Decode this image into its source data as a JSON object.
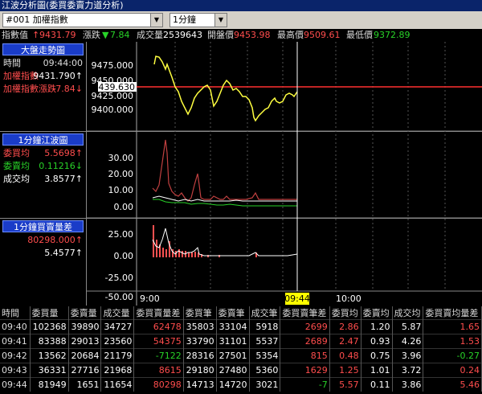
{
  "window": {
    "title": "江波分析圖(委買委賣力道分析)"
  },
  "controls": {
    "symbol": "#001 加權指數",
    "interval": "1分鐘"
  },
  "quote": {
    "index_label": "指數值",
    "index_arrow": "↑",
    "index_value": "9431.79",
    "change_label": "漲跌",
    "change_arrow": "▼",
    "change_value": "7.84",
    "volume_label": "成交量",
    "volume_value": "2539643",
    "open_label": "開盤價",
    "open_value": "9453.98",
    "high_label": "最高價",
    "high_value": "9509.61",
    "low_label": "最低價",
    "low_value": "9372.89"
  },
  "panel1": {
    "title": "大盤走勢圖",
    "rows": [
      {
        "label": "時間",
        "value": "09:44:00"
      },
      {
        "label": "加權指數",
        "value": "9431.790↑"
      },
      {
        "label": "加權指數漲跌",
        "value": "-7.84↓"
      }
    ],
    "y_ticks": [
      "9475.000",
      "9450.000",
      "9425.000",
      "9400.000"
    ],
    "ref_label": "9439.630"
  },
  "panel2": {
    "title": "1分鐘江波圖",
    "rows": [
      {
        "label": "委買均",
        "value": "5.5698↑"
      },
      {
        "label": "委賣均",
        "value": "0.11216↓"
      },
      {
        "label": "成交均",
        "value": "3.8577↑"
      }
    ],
    "y_ticks": [
      "30.00",
      "20.00",
      "10.00",
      "0.00"
    ]
  },
  "panel3": {
    "title": "1分鐘買賣量差",
    "rows": [
      {
        "value": "80298.000↑"
      },
      {
        "value": "5.4577↑"
      }
    ],
    "y_ticks": [
      "25.00",
      "0.00",
      "-25.00",
      "-50.00"
    ]
  },
  "time_axis": {
    "start": "9:00",
    "cursor": "09:44",
    "mid": "10:00"
  },
  "table": {
    "headers": [
      "時間",
      "委買量",
      "委賣量",
      "成交量",
      "委買賣量差",
      "委買筆",
      "委賣筆",
      "成交筆",
      "委買賣筆差",
      "委買均",
      "委賣均",
      "成交均",
      "委買賣均量差"
    ],
    "rows": [
      [
        "09:40",
        "102368",
        "39890",
        "34727",
        "62478",
        "35803",
        "33104",
        "5918",
        "2699",
        "2.86",
        "1.20",
        "5.87",
        "1.65"
      ],
      [
        "09:41",
        "83388",
        "29013",
        "23560",
        "54375",
        "33790",
        "31101",
        "5537",
        "2689",
        "2.47",
        "0.93",
        "4.26",
        "1.53"
      ],
      [
        "09:42",
        "13562",
        "20684",
        "21179",
        "-7122",
        "28316",
        "27501",
        "5354",
        "815",
        "0.48",
        "0.75",
        "3.96",
        "-0.27"
      ],
      [
        "09:43",
        "36331",
        "27716",
        "21968",
        "8615",
        "29180",
        "27480",
        "5360",
        "1629",
        "1.25",
        "1.01",
        "3.72",
        "0.24"
      ],
      [
        "09:44",
        "81949",
        "1651",
        "11654",
        "80298",
        "14713",
        "14720",
        "3021",
        "-7",
        "5.57",
        "0.11",
        "3.86",
        "5.46"
      ]
    ]
  },
  "colors": {
    "red": "#ff4d4d",
    "green": "#28d228",
    "yellow": "#ffff00",
    "title_blue": "#1a3cc8"
  }
}
